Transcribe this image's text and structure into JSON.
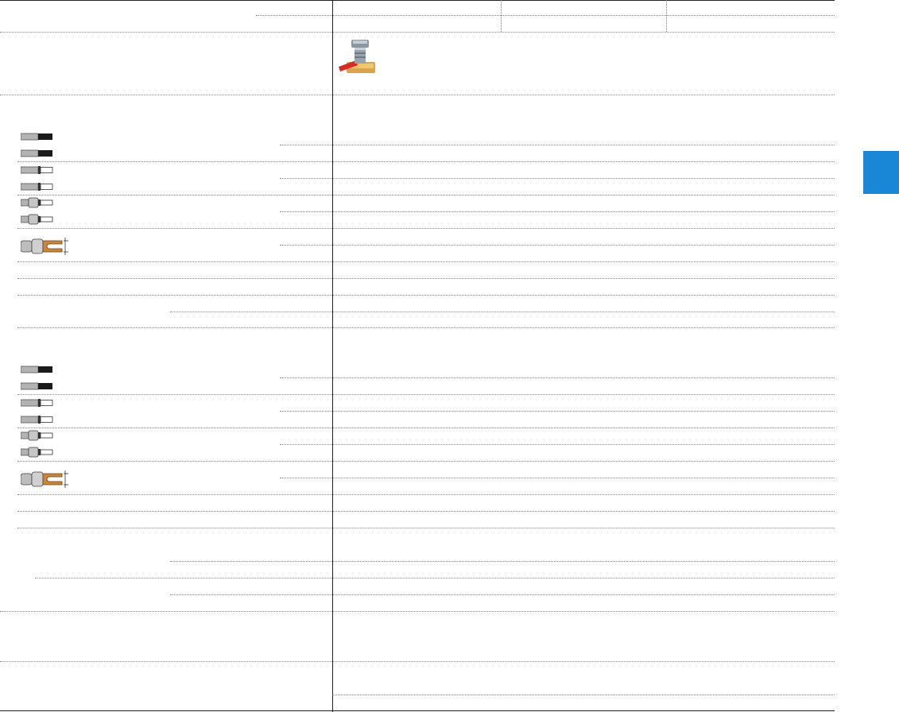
{
  "colors": {
    "tab_blue": "#1a86d6",
    "grid_line": "#8a8a8a",
    "border_line": "#222222",
    "ferrule_dark": "#1b1b1b",
    "ferrule_metal": "#b3b3b3",
    "fork_copper": "#c9853d"
  },
  "icons": {
    "header": "screw-terminal-icon",
    "bare_ferrule": "ferrule-bare-icon",
    "insulated_ferrule": "ferrule-insulated-icon",
    "collar_ferrule": "ferrule-collar-icon",
    "fork_terminal": "fork-terminal-icon"
  },
  "page": {
    "side_tab_label": "",
    "sections": [
      {
        "name": "section-1",
        "rows": [
          "bare",
          "bare",
          "insulated",
          "insulated",
          "collar",
          "collar",
          "fork"
        ]
      },
      {
        "name": "section-2",
        "rows": [
          "bare",
          "bare",
          "insulated",
          "insulated",
          "collar",
          "collar",
          "fork"
        ]
      }
    ]
  }
}
